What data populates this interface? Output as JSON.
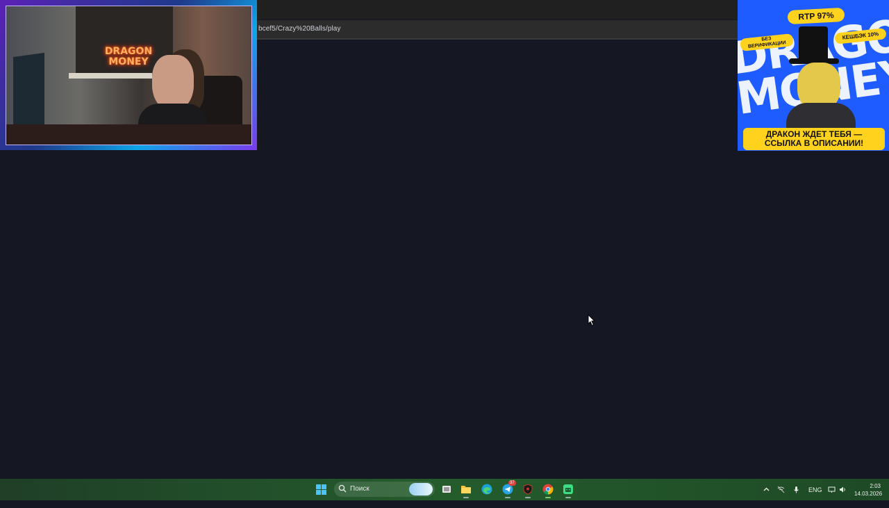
{
  "browser": {
    "url": "bcef5/Crazy%20Balls/play"
  },
  "webcam": {
    "neon_sign": "DRAGON MONEY"
  },
  "ad": {
    "background_lettering": "DRAGON MONEY",
    "rtp": "RTP 97%",
    "cashback": "КЕШБЭК 10%",
    "no_verification_line1": "БЕЗ",
    "no_verification_line2": "ВЕРИФИКАЦИИ",
    "caption_line1": "ДРАКОН ЖДЕТ ТЕБЯ —",
    "caption_line2": "ССЫЛКА В ОПИСАНИИ!"
  },
  "taskbar": {
    "search_placeholder": "Поиск",
    "apps": [
      {
        "name": "task-view",
        "icon": "task-view-icon"
      },
      {
        "name": "file-explorer",
        "icon": "folder-icon"
      },
      {
        "name": "edge",
        "icon": "edge-icon"
      },
      {
        "name": "telegram",
        "icon": "telegram-icon",
        "badge": "37"
      },
      {
        "name": "shield-app",
        "icon": "shield-icon"
      },
      {
        "name": "chrome",
        "icon": "chrome-icon",
        "active": true
      },
      {
        "name": "android-app",
        "icon": "android-icon"
      }
    ],
    "language": "ENG",
    "time": "2:03",
    "date": "14.03.2026"
  },
  "colors": {
    "page_bg": "#151823",
    "taskbar": "#245c2c",
    "ad_blue": "#1f5cff",
    "ad_yellow": "#ffd21e"
  }
}
